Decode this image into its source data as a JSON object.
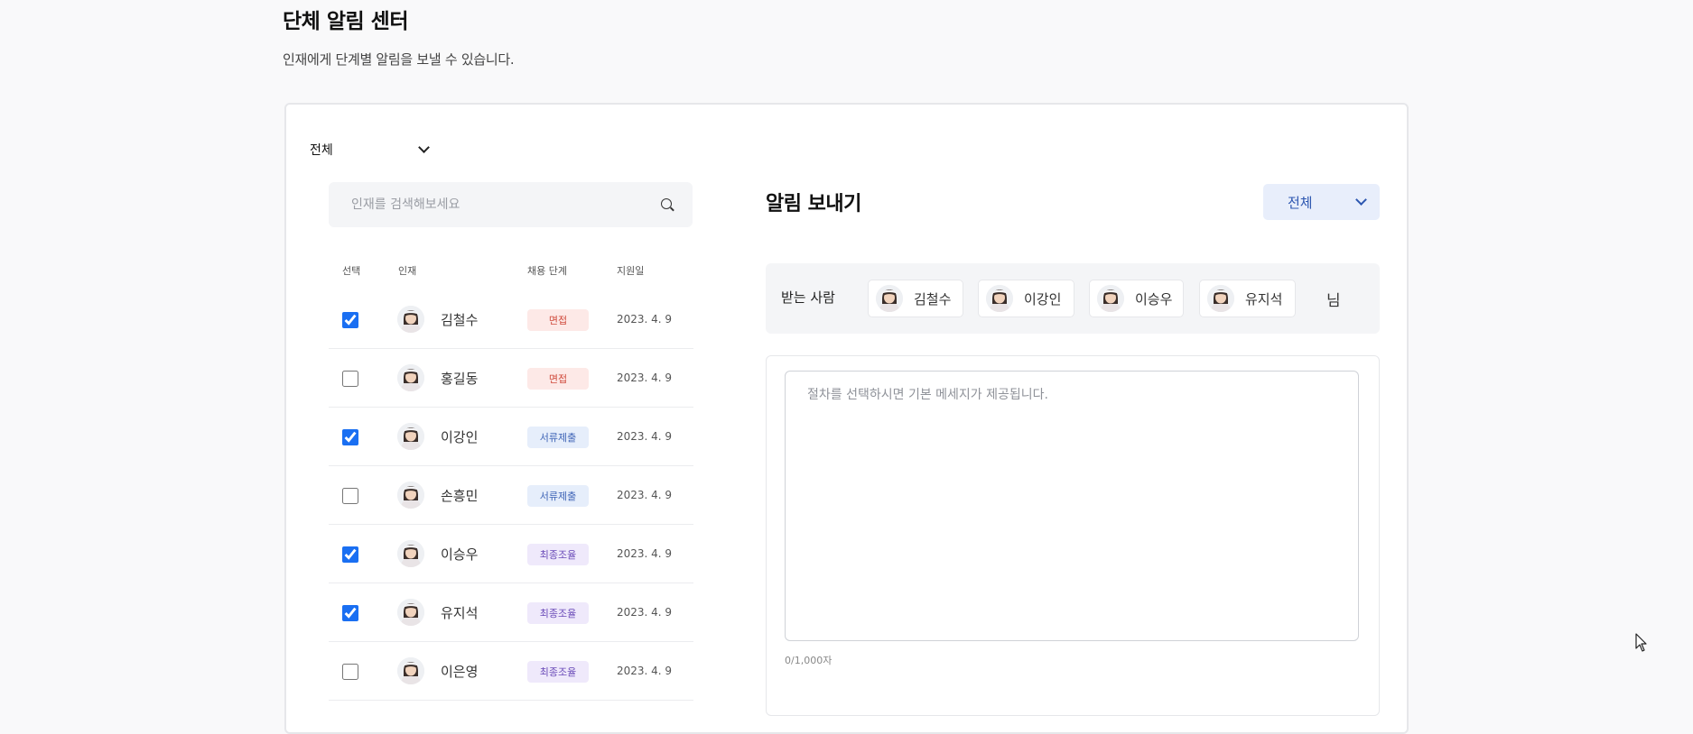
{
  "page": {
    "title": "단체 알림 센터",
    "subtitle": "인재에게 단계별 알림을 보낼 수 있습니다."
  },
  "filter": {
    "selected": "전체"
  },
  "search": {
    "placeholder": "인재를 검색해보세요",
    "icon": "search-icon"
  },
  "table": {
    "headers": {
      "select": "선택",
      "talent": "인재",
      "stage": "채용 단계",
      "date": "지원일"
    },
    "rows": [
      {
        "name": "김철수",
        "stage": "면접",
        "stage_color": "red",
        "date": "2023. 4. 9",
        "checked": true
      },
      {
        "name": "홍길동",
        "stage": "면접",
        "stage_color": "red",
        "date": "2023. 4. 9",
        "checked": false
      },
      {
        "name": "이강인",
        "stage": "서류제출",
        "stage_color": "blue",
        "date": "2023. 4. 9",
        "checked": true
      },
      {
        "name": "손흥민",
        "stage": "서류제출",
        "stage_color": "blue",
        "date": "2023. 4. 9",
        "checked": false
      },
      {
        "name": "이승우",
        "stage": "최종조율",
        "stage_color": "purple",
        "date": "2023. 4. 9",
        "checked": true
      },
      {
        "name": "유지석",
        "stage": "최종조율",
        "stage_color": "purple",
        "date": "2023. 4. 9",
        "checked": true
      },
      {
        "name": "이은영",
        "stage": "최종조율",
        "stage_color": "purple",
        "date": "2023. 4. 9",
        "checked": false
      }
    ]
  },
  "send": {
    "title": "알림 보내기",
    "select": "전체",
    "recipients_label": "받는 사람",
    "recipients": [
      "김철수",
      "이강인",
      "이승우",
      "유지석"
    ],
    "suffix": "님",
    "message_placeholder": "절차를 선택하시면 기본 메세지가 제공됩니다.",
    "counter": "0/1,000자"
  },
  "colors": {
    "accent": "#1a6ff2",
    "badge_red_bg": "#fde9e7",
    "badge_blue_bg": "#e6eefb",
    "badge_purple_bg": "#efe9fb"
  }
}
